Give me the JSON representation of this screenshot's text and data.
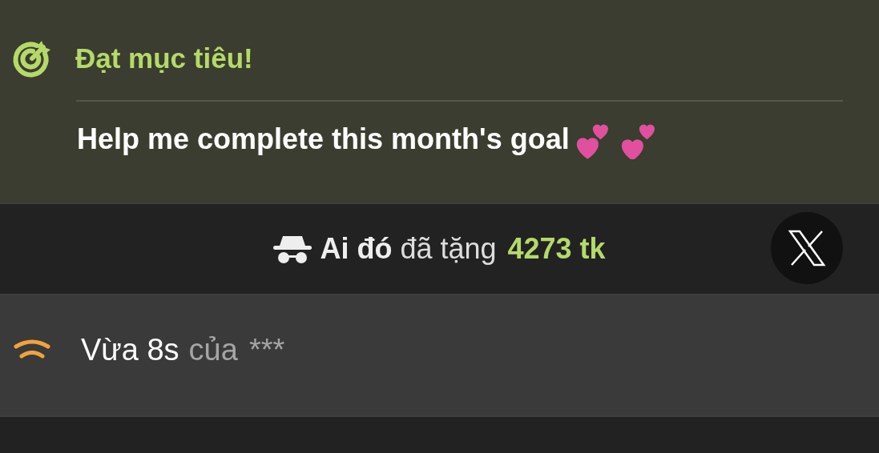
{
  "goal": {
    "title": "Đạt mục tiêu!",
    "message": "Help me complete this month's goal"
  },
  "feed": [
    {
      "kind": "gift",
      "sender": "Ai đó",
      "verb": "đã tặng",
      "amount": "4273 tk"
    },
    {
      "kind": "comment",
      "time": "Vừa 8s",
      "by": "của",
      "author": "***"
    }
  ]
}
